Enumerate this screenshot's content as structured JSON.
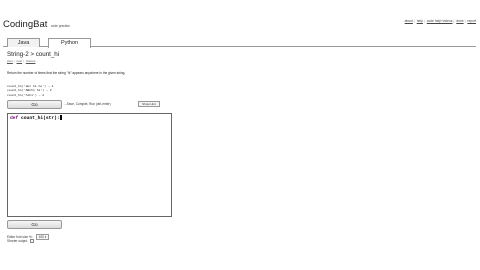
{
  "header": {
    "brand": "CodingBat",
    "tagline": "code practice",
    "nav_links": [
      "about",
      "help",
      "code help+videos",
      "done",
      "report"
    ]
  },
  "tabs": [
    {
      "label": "Java",
      "active": false
    },
    {
      "label": "Python",
      "active": true
    }
  ],
  "problem": {
    "title": "String-2 > count_hi",
    "subnav": [
      "prev",
      "next",
      "chance"
    ],
    "description": "Return the number of times that the string \"hi\" appears anywhere in the given string.",
    "examples": [
      "count_hi('abc hi ho') → 1",
      "count_hi('ABChi hi') → 2",
      "count_hi('hihi') → 2"
    ]
  },
  "controls": {
    "go_label": "Go",
    "hint": "...Save, Compile, Run (ctrl-enter)",
    "show_hint_label": "Show Hint"
  },
  "editor": {
    "code_keyword": "def",
    "code_rest": "count_hi(str):"
  },
  "footer": {
    "editor_font_label": "Editor font size %:",
    "editor_font_value": "100",
    "shorter_output_label": "Shorter output"
  }
}
